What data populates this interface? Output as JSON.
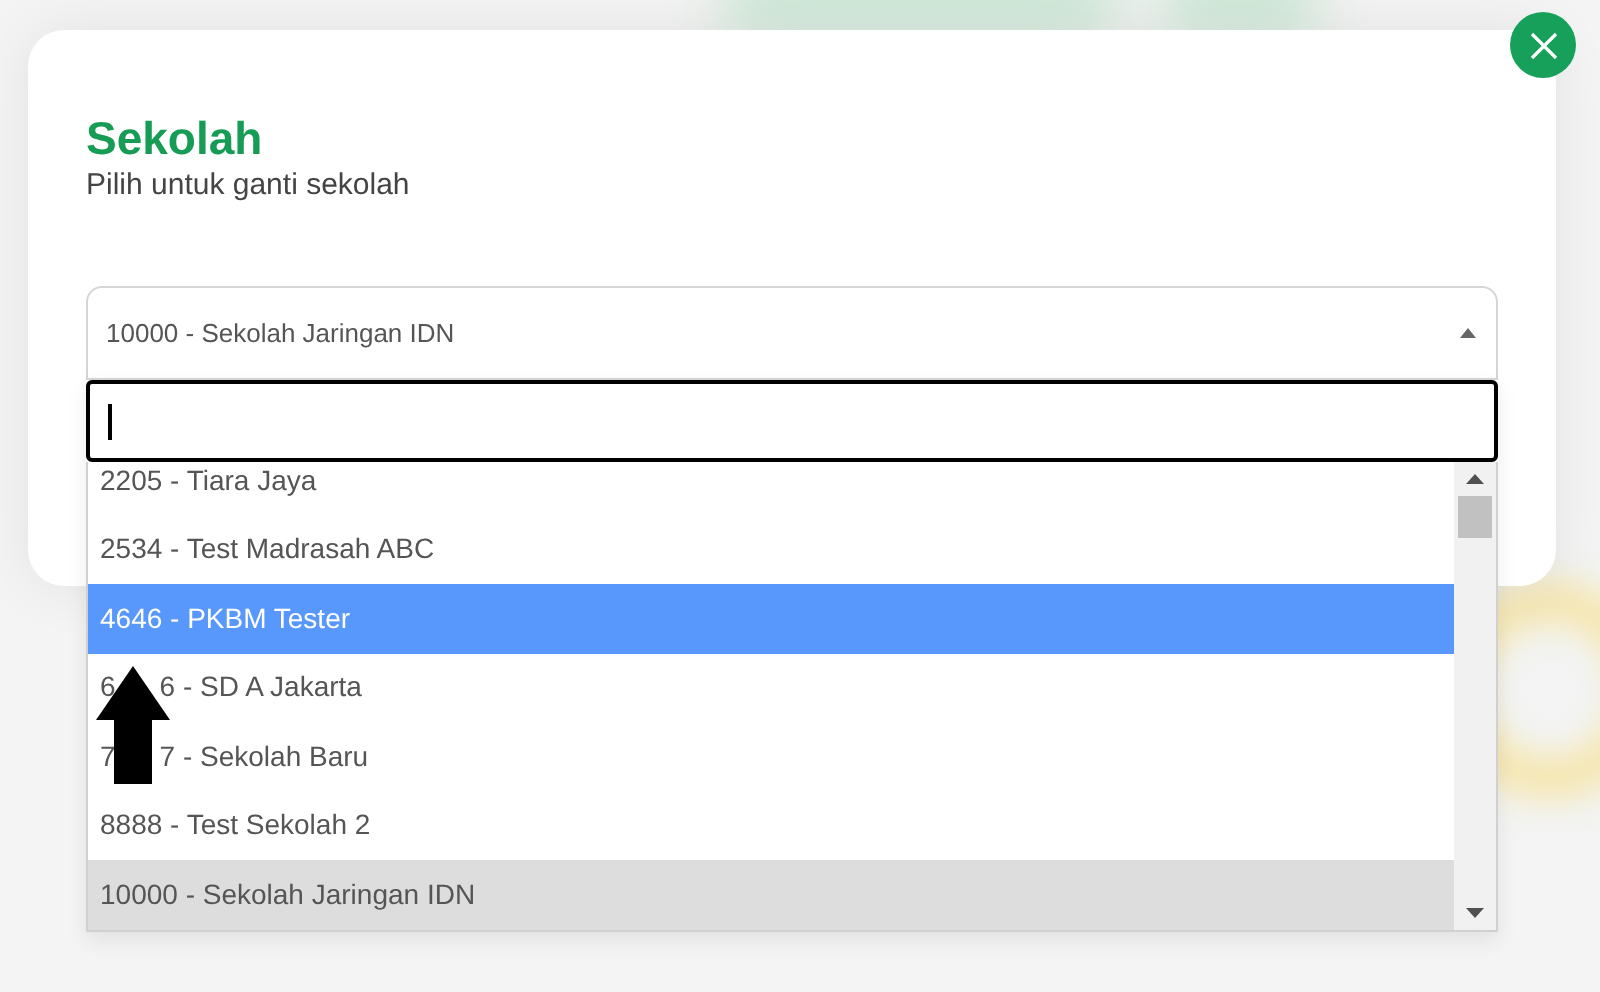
{
  "dialog": {
    "title": "Sekolah",
    "subtitle": "Pilih untuk ganti sekolah",
    "select": {
      "value": "10000 - Sekolah Jaringan IDN",
      "expanded": true
    },
    "search": {
      "focused": true
    },
    "options": [
      {
        "parts": [
          "2205 - Tiara Jaya"
        ],
        "highlighted": false,
        "selected": false
      },
      {
        "parts": [
          "2534 - Test Madrasah ABC"
        ],
        "highlighted": false,
        "selected": false
      },
      {
        "parts": [
          "4646 - PKBM Tester"
        ],
        "highlighted": true,
        "selected": false
      },
      {
        "parts": [
          "6",
          "6 - SD A Jakarta"
        ],
        "highlighted": false,
        "selected": false
      },
      {
        "parts": [
          "7",
          "7 - Sekolah Baru"
        ],
        "highlighted": false,
        "selected": false
      },
      {
        "parts": [
          "8888 - Test Sekolah 2"
        ],
        "highlighted": false,
        "selected": false
      },
      {
        "parts": [
          "10000 - Sekolah Jaringan IDN"
        ],
        "highlighted": false,
        "selected": true
      }
    ]
  }
}
